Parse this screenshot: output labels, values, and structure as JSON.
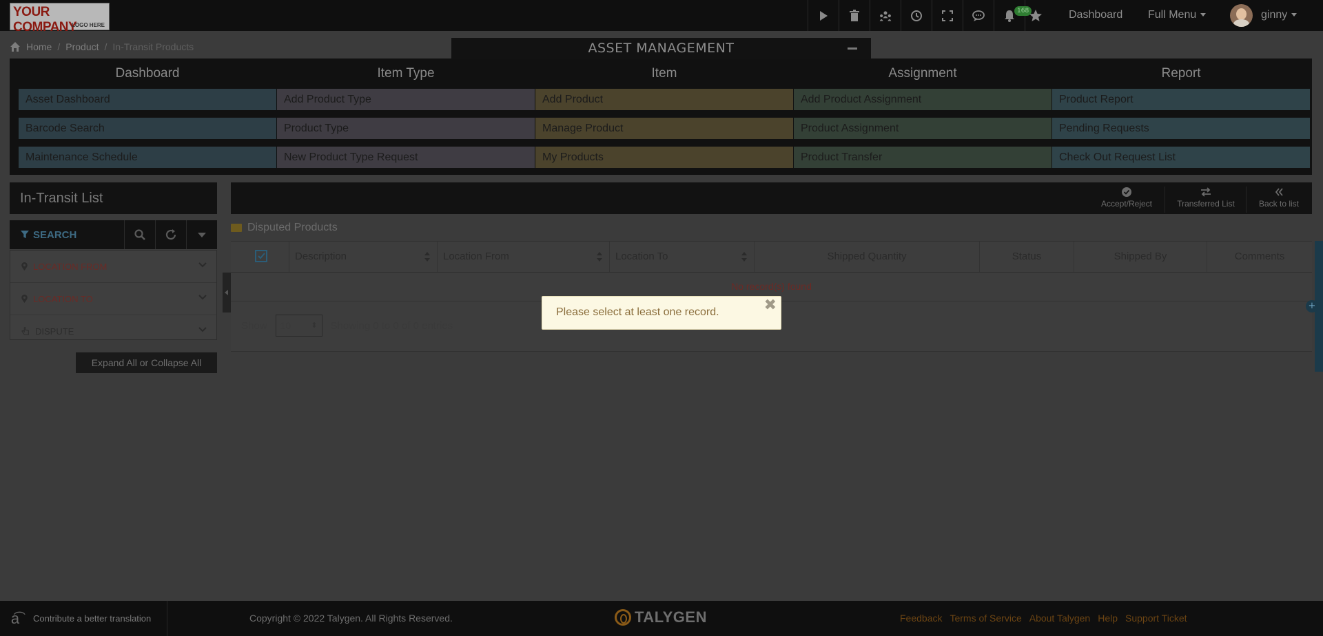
{
  "topbar": {
    "logo_line1": "YOUR COMPANY",
    "logo_line2": "LOGO HERE",
    "icons": [
      "play-icon",
      "trash-icon",
      "people-icon",
      "clock-icon",
      "fullscreen-icon",
      "chat-icon",
      "bell-icon",
      "star-icon"
    ],
    "notification_count": "168",
    "dashboard_label": "Dashboard",
    "full_menu_label": "Full Menu",
    "user_name": "ginny"
  },
  "breadcrumb": {
    "items": [
      "Home",
      "Product",
      "In-Transit Products"
    ]
  },
  "asset_management": {
    "title": "ASSET MANAGEMENT",
    "columns": [
      {
        "header": "Dashboard",
        "color": "#2d3e46",
        "items": [
          "Asset Dashboard",
          "Barcode Search",
          "Maintenance Schedule"
        ]
      },
      {
        "header": "Item Type",
        "color": "#3f3c43",
        "items": [
          "Add Product Type",
          "Product Type",
          "New Product Type Request"
        ]
      },
      {
        "header": "Item",
        "color": "#4b432c",
        "items": [
          "Add Product",
          "Manage Product",
          "My Products"
        ]
      },
      {
        "header": "Assignment",
        "color": "#334036",
        "items": [
          "Add Product Assignment",
          "Product Assignment",
          "Product Transfer"
        ]
      },
      {
        "header": "Report",
        "color": "#2f4349",
        "items": [
          "Product Report",
          "Pending Requests",
          "Check Out Request List"
        ]
      }
    ]
  },
  "left_panel": {
    "title": "In-Transit List",
    "search_label": "SEARCH",
    "filters": [
      "LOCATION FROM",
      "LOCATION TO",
      "DISPUTE"
    ],
    "expand_label": "Expand All or Collapse All"
  },
  "main_panel": {
    "actions": [
      "Accept/Reject",
      "Transferred List",
      "Back to list"
    ],
    "section_title": "Disputed Products",
    "columns": [
      "Description",
      "Location From",
      "Location To",
      "Shipped Quantity",
      "Status",
      "Shipped By",
      "Comments"
    ],
    "empty_message": "No record(s) found",
    "show_label": "Show",
    "page_size": "10",
    "entries_text": "Showing 0 to 0 of 0 entries"
  },
  "toast": {
    "message": "Please select at least one record.",
    "close_symbol": "✖"
  },
  "footer": {
    "translate_label": "Contribute a better translation",
    "copyright": "Copyright © 2022 Talygen. All Rights Reserved.",
    "brand": "TALYGEN",
    "links": [
      "Feedback",
      "Terms of Service",
      "About Talygen",
      "Help",
      "Support Ticket"
    ]
  },
  "colors": {
    "toast_bg": "#fcf8e3",
    "toast_text": "#8a6d3b",
    "accent_blue": "#2b5d78",
    "error_red": "#6b2a25"
  }
}
